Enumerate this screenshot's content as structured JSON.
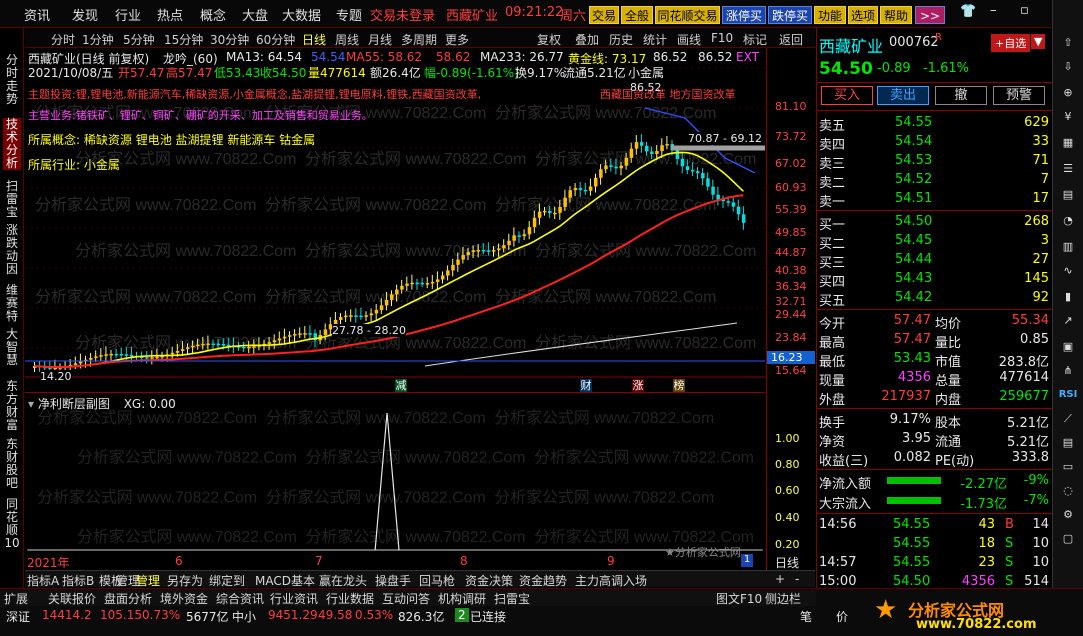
{
  "menu": {
    "items": [
      "资讯",
      "发现",
      "行业",
      "热点",
      "概念",
      "大盘",
      "大数据",
      "专题"
    ],
    "trade_status": "交易未登录",
    "stock_name": "西藏矿业",
    "time": "09:21:22",
    "weekday": "周六",
    "buttons": [
      "交易",
      "全般",
      "同花顺交易",
      "涨停买",
      "跌停买",
      "功能",
      "选项",
      "帮助"
    ],
    "more": ">>"
  },
  "sidebar": [
    "分时走势",
    "技术分析",
    "扫雷宝",
    "涨跌动因",
    "维赛特",
    "大智慧",
    "东方财富",
    "东财股吧",
    "同花顺10"
  ],
  "periods": [
    "分时",
    "1分钟",
    "5分钟",
    "15分钟",
    "30分钟",
    "60分钟",
    "日线",
    "周线",
    "月线",
    "多周期",
    "更多"
  ],
  "period_active": "日线",
  "toolbar_right": [
    "复权",
    "叠加",
    "历史",
    "统计",
    "画线",
    "F10",
    "标记",
    "返回"
  ],
  "chart": {
    "line1": {
      "name": "西藏矿业(日线 前复权)",
      "ind": "龙吟_(60)",
      "ma13": "MA13: 64.54",
      "v1": "54.54",
      "ma55": "MA55: 58.62",
      "v2": "58.62",
      "ma233": "MA233: 26.77",
      "gold": "黄金线: 73.17",
      "v3": "86.52",
      "v4": "86.52",
      "ext": "EXT"
    },
    "line2": {
      "date": "2021/10/08/五",
      "open": "开57.47",
      "high": "高57.47",
      "low": "低53.43",
      "close": "收54.50",
      "vol": "量477614",
      "amt": "额26.4亿",
      "chg": "幅-0.89(-1.61%)",
      "turn": "换9.17%",
      "float": "流通5.21亿",
      "ind": "小金属"
    },
    "business": "主营业务:锗铁矿、锂矿、铜矿、硼矿的开采、加工及销售和贸易业务。",
    "concepts_label": "所属概念:",
    "concepts": "稀缺资源 锂电池 盐湖提锂 新能源车 钴金属",
    "industry_label": "所属行业:",
    "industry": "小金属",
    "hotline": "主题投资:锂,锂电池,新能源汽车,稀缺资源,小金属概念,盐湖提锂,锂电原料,锂铁,西藏国资改革,",
    "hotline2": "西藏国资改革 地方国资改革",
    "annot_top": "86.52",
    "annot_mid": "70.87 - 69.12",
    "annot_low": "27.78 - 28.20",
    "annot_start": "14.20",
    "price_tag": "16.23",
    "watermark": "分析家公式网 www.70822.Com",
    "markers": [
      "减",
      "财",
      "涨",
      "榜"
    ]
  },
  "chart_scale": [
    "81.10",
    "73.72",
    "67.02",
    "60.93",
    "55.39",
    "49.85",
    "44.87",
    "40.38",
    "36.34",
    "32.71",
    "29.44",
    "23.84",
    "16.23",
    "15.64"
  ],
  "sub": {
    "title": "净利断层副图",
    "xg": "XG: 0.00",
    "scale": [
      "1.00",
      "0.80",
      "0.60",
      "0.40",
      "0.20"
    ],
    "year": "2021年",
    "months": [
      "6",
      "7",
      "8",
      "9"
    ],
    "source": "★分析家公式网",
    "cycle": "日线"
  },
  "tabs": [
    "指标A",
    "指标B",
    "模板",
    "管理",
    "另存为",
    "绑定到",
    "MACD基本",
    "赢在龙头",
    "操盘手",
    "回马枪",
    "资金决策",
    "资金趋势",
    "主力高调入场"
  ],
  "tab_active": "管理",
  "footer": {
    "row1": [
      "扩展",
      "关联报价",
      "盘面分析",
      "境外资金",
      "综合资讯",
      "行业资讯",
      "行业数据",
      "互动问答",
      "机构调研",
      "扫雷宝"
    ],
    "sz_label": "深证",
    "sz_val": "14414.2",
    "sz_chg": "105.15",
    "sz_pct": "0.73%",
    "sz_amt": "5677亿",
    "zx_label": "中小",
    "zx_val": "9451.29",
    "zx_chg": "49.58",
    "zx_pct": "0.53%",
    "zx_amt": "826.3亿",
    "conn_no": "2",
    "conn": "已连接",
    "right": [
      "图文F10",
      "侧边栏",
      "笔",
      "价"
    ],
    "brand": "分析家公式网",
    "brand_url": "www.70822.com"
  },
  "quote": {
    "name": "西藏矿业",
    "code": "000762",
    "flag": "R",
    "add": "+自选",
    "price": "54.50",
    "chg": "-0.89",
    "pct": "-1.61%",
    "actions": [
      "买入",
      "卖出",
      "撤",
      "预警"
    ],
    "asks": [
      {
        "label": "卖五",
        "price": "54.55",
        "vol": "629"
      },
      {
        "label": "卖四",
        "price": "54.54",
        "vol": "33"
      },
      {
        "label": "卖三",
        "price": "54.53",
        "vol": "71"
      },
      {
        "label": "卖二",
        "price": "54.52",
        "vol": "7"
      },
      {
        "label": "卖一",
        "price": "54.51",
        "vol": "17"
      }
    ],
    "bids": [
      {
        "label": "买一",
        "price": "54.50",
        "vol": "268"
      },
      {
        "label": "买二",
        "price": "54.45",
        "vol": "3"
      },
      {
        "label": "买三",
        "price": "54.44",
        "vol": "27"
      },
      {
        "label": "买四",
        "price": "54.43",
        "vol": "145"
      },
      {
        "label": "买五",
        "price": "54.42",
        "vol": "92"
      }
    ],
    "stats": [
      {
        "l1": "今开",
        "v1": "57.47",
        "l2": "均价",
        "v2": "55.34"
      },
      {
        "l1": "最高",
        "v1": "57.47",
        "l2": "量比",
        "v2": "0.85"
      },
      {
        "l1": "最低",
        "v1": "53.43",
        "l2": "市值",
        "v2": "283.8亿"
      },
      {
        "l1": "现量",
        "v1": "4356",
        "l2": "总量",
        "v2": "477614"
      },
      {
        "l1": "外盘",
        "v1": "217937",
        "l2": "内盘",
        "v2": "259677"
      }
    ],
    "stats2": [
      {
        "l1": "换手",
        "v1": "9.17%",
        "l2": "股本",
        "v2": "5.21亿"
      },
      {
        "l1": "净资",
        "v1": "3.95",
        "l2": "流通",
        "v2": "5.21亿"
      },
      {
        "l1": "收益(三)",
        "v1": "0.082",
        "l2": "PE(动)",
        "v2": "333.8"
      }
    ],
    "flows": [
      {
        "label": "净流入额",
        "val": "-2.27亿",
        "pct": "-9%"
      },
      {
        "label": "大宗流入",
        "val": "-1.73亿",
        "pct": "-7%"
      }
    ],
    "ticks": [
      {
        "t": "14:56",
        "p": "54.55",
        "v": "43",
        "d": "B",
        "n": "14"
      },
      {
        "t": "",
        "p": "54.55",
        "v": "18",
        "d": "S",
        "n": "10"
      },
      {
        "t": "14:57",
        "p": "54.55",
        "v": "23",
        "d": "S",
        "n": "10"
      },
      {
        "t": "15:00",
        "p": "54.50",
        "v": "4356",
        "d": "S",
        "n": "514"
      }
    ]
  },
  "right_tools": [
    "RSI"
  ]
}
